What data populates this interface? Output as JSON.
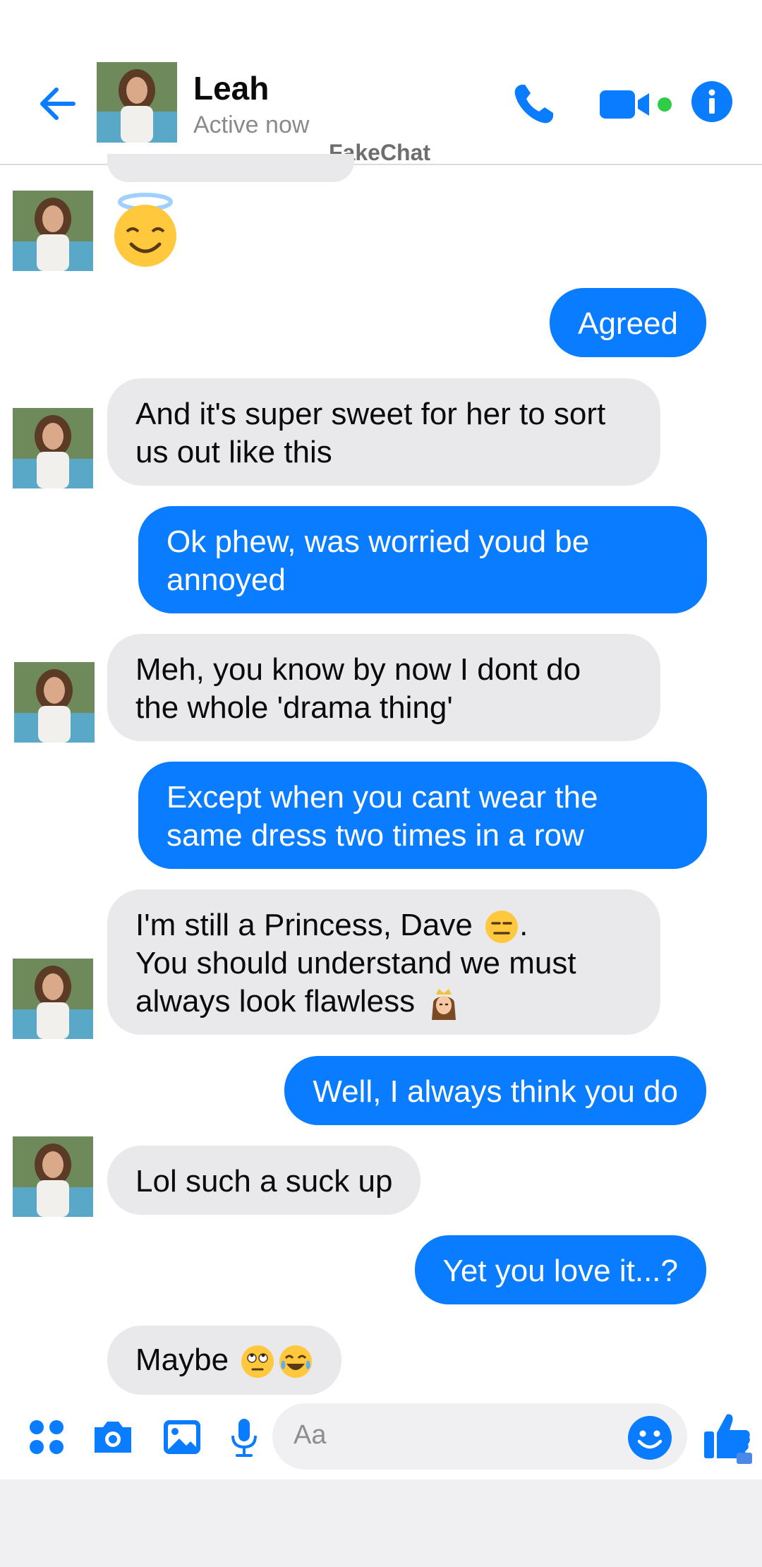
{
  "header": {
    "contact_name": "Leah",
    "status": "Active now",
    "watermark": "FakeChat"
  },
  "icons": {
    "back": "arrow-left-icon",
    "phone": "phone-icon",
    "video": "video-camera-icon",
    "info": "info-icon",
    "apps": "four-dots-icon",
    "camera": "camera-icon",
    "gallery": "image-icon",
    "mic": "microphone-icon",
    "emoji": "smiley-icon",
    "like": "thumbs-up-icon"
  },
  "colors": {
    "accent": "#0a7cff",
    "incoming_bubble": "#e9e9eb",
    "online": "#31cc46"
  },
  "messages": [
    {
      "from": "them",
      "emoji": "smiling-face-with-halo"
    },
    {
      "from": "me",
      "text": "Agreed"
    },
    {
      "from": "them",
      "text": "And it's super sweet for her to sort us out like this"
    },
    {
      "from": "me",
      "text": "Ok phew, was worried youd be annoyed"
    },
    {
      "from": "them",
      "text": "Meh, you know by now I dont do the whole 'drama thing'"
    },
    {
      "from": "me",
      "text": "Except when you cant wear the same dress two times in a row"
    },
    {
      "from": "them",
      "text_line1": "I'm still a Princess, Dave",
      "text_line1_end": ".",
      "text_line2": "You should understand we must always look flawless",
      "emojis": [
        "expressionless-face",
        "princess"
      ]
    },
    {
      "from": "me",
      "text": "Well, I always think you do"
    },
    {
      "from": "them",
      "text": "Lol such a suck up"
    },
    {
      "from": "me",
      "text": "Yet you love it...?"
    },
    {
      "from": "them",
      "text": "Maybe",
      "emojis": [
        "face-with-rolling-eyes",
        "face-with-tears-of-joy"
      ]
    }
  ],
  "composer": {
    "placeholder": "Aa"
  }
}
